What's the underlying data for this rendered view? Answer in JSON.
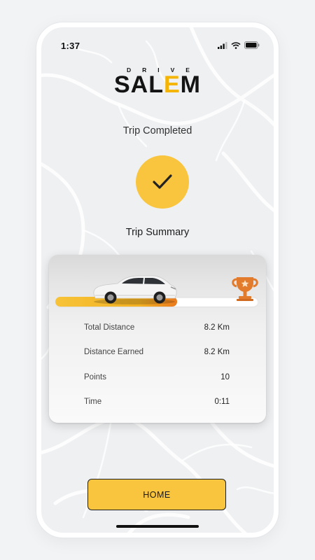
{
  "status_bar": {
    "time": "1:37"
  },
  "logo": {
    "top_text": "DRIVE",
    "main_prefix": "SAL",
    "main_accent": "E",
    "main_suffix": "M",
    "accent_color": "#f4b400"
  },
  "header": {
    "trip_completed": "Trip Completed"
  },
  "summary": {
    "title": "Trip Summary",
    "progress": 0.6,
    "rows": [
      {
        "label": "Total Distance",
        "value": "8.2 Km"
      },
      {
        "label": "Distance Earned",
        "value": "8.2 Km"
      },
      {
        "label": "Points",
        "value": "10"
      },
      {
        "label": "Time",
        "value": "0:11"
      }
    ]
  },
  "home_button": {
    "label": "HOME"
  },
  "colors": {
    "primary_yellow": "#f9c53e",
    "progress_orange": "#ea7a1e",
    "trophy_orange": "#e27b2c"
  }
}
